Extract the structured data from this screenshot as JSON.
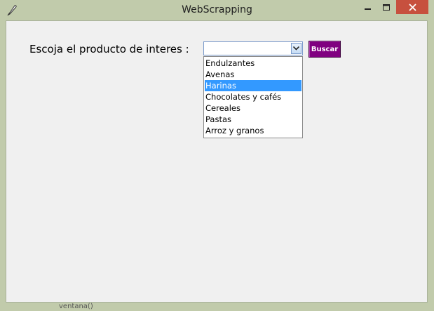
{
  "window": {
    "title": "WebScrapping",
    "close_color": "#c7503e",
    "frame_color": "#c1cbab"
  },
  "icons": {
    "app": "feather-icon",
    "minimize": "minimize-icon",
    "maximize": "maximize-icon",
    "close": "close-icon",
    "dropdown": "chevron-down-icon"
  },
  "form": {
    "label": "Escoja el producto de interes :",
    "combo_value": "",
    "button_label": "Buscar",
    "button_color": "#800080"
  },
  "dropdown": {
    "selected_index": 2,
    "options": [
      {
        "label": "Endulzantes"
      },
      {
        "label": "Avenas"
      },
      {
        "label": "Harinas"
      },
      {
        "label": "Chocolates y cafés"
      },
      {
        "label": "Cereales"
      },
      {
        "label": "Pastas"
      },
      {
        "label": "Arroz y granos"
      }
    ]
  },
  "background_text": "ventana()"
}
